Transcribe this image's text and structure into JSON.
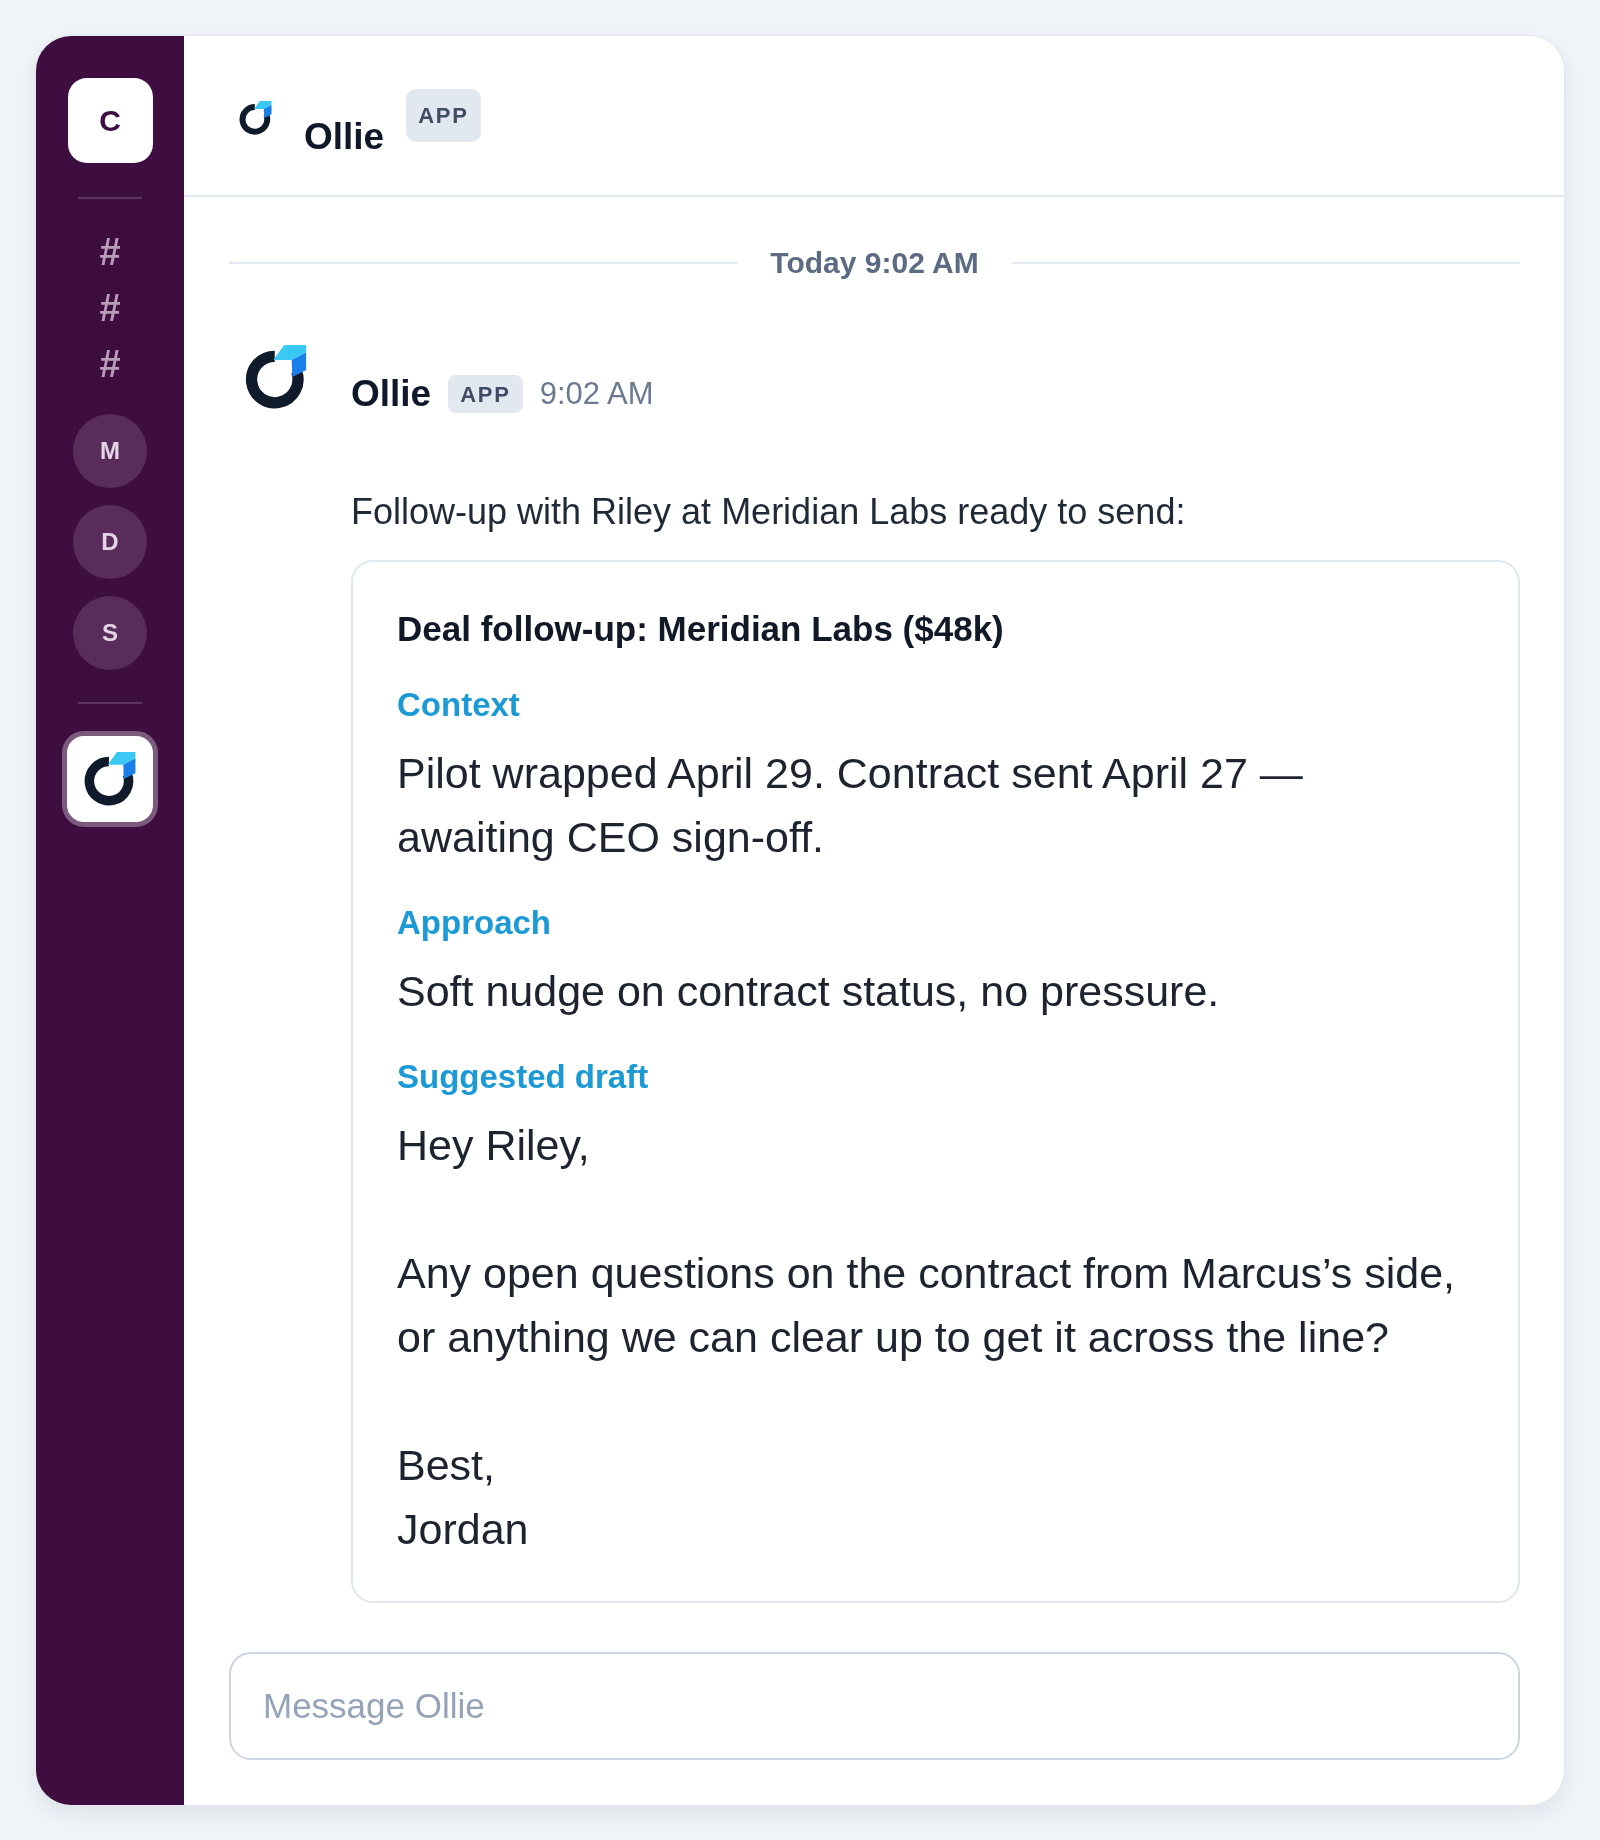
{
  "sidebar": {
    "workspace": {
      "initial": "C"
    },
    "channels": [
      {
        "symbol": "#",
        "selected": false
      },
      {
        "symbol": "#",
        "selected": false
      },
      {
        "symbol": "#",
        "selected": false
      }
    ],
    "direct_messages": [
      {
        "initial": "M",
        "selected": false
      },
      {
        "initial": "D",
        "selected": false
      },
      {
        "initial": "S",
        "selected": false
      }
    ],
    "apps": [
      {
        "selected": true
      }
    ]
  },
  "header": {
    "title": "Ollie",
    "badge": "APP"
  },
  "date_divider": "Today 9:02 AM",
  "messages": [
    {
      "sender": "Ollie",
      "badge": "APP",
      "time": "9:02 AM",
      "text": "Follow-up with Riley at Meridian Labs ready to send:",
      "card": {
        "title": "Deal follow-up: Meridian Labs ($48k)",
        "sections": [
          {
            "heading": "Context",
            "body": "Pilot wrapped April 29. Contract sent April 27 — awaiting CEO sign-off."
          },
          {
            "heading": "Approach",
            "body": "Soft nudge on contract status, no pressure."
          },
          {
            "heading": "Suggested draft",
            "body": "Hey Riley,\n\nAny open questions on the contract from Marcus’s side, or anything we can clear up to get it across the line?\n\nBest,\nJordan"
          }
        ]
      }
    }
  ],
  "composer": {
    "placeholder": "Message Ollie"
  }
}
